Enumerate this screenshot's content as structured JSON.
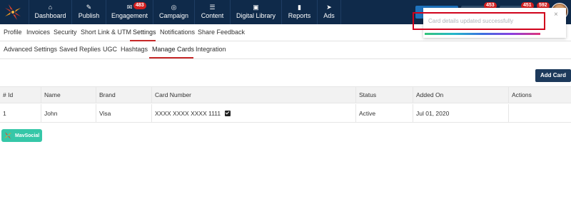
{
  "nav": {
    "items": [
      {
        "label": "Dashboard",
        "icon": "home-icon",
        "glyph": "⌂"
      },
      {
        "label": "Publish",
        "icon": "edit-icon",
        "glyph": "✎"
      },
      {
        "label": "Engagement",
        "icon": "envelope-icon",
        "glyph": "✉",
        "badge": "483"
      },
      {
        "label": "Campaign",
        "icon": "target-icon",
        "glyph": "◎"
      },
      {
        "label": "Content",
        "icon": "list-icon",
        "glyph": "☰"
      },
      {
        "label": "Digital Library",
        "icon": "briefcase-icon",
        "glyph": "▣"
      },
      {
        "label": "Reports",
        "icon": "bar-chart-icon",
        "glyph": "▮"
      },
      {
        "label": "Ads",
        "icon": "paper-plane-icon",
        "glyph": "➤"
      }
    ],
    "right_badges": [
      "453",
      "451",
      "592"
    ]
  },
  "tabs_primary": [
    "Profile",
    "Invoices",
    "Security",
    "Short Link & UTM",
    "Settings",
    "Notifications",
    "Share Feedback"
  ],
  "tabs_secondary": [
    "Advanced Settings",
    "Saved Replies",
    "UGC",
    "Hashtags",
    "Manage Cards",
    "Integration"
  ],
  "active_primary": "Settings",
  "active_secondary": "Manage Cards",
  "add_card_label": "Add Card",
  "table": {
    "headers": [
      "# Id",
      "Name",
      "Brand",
      "Card Number",
      "Status",
      "Added On",
      "Actions"
    ],
    "rows": [
      {
        "id": "1",
        "name": "John",
        "brand": "Visa",
        "card_number": "XXXX XXXX XXXX 1111",
        "status": "Active",
        "added_on": "Jul 01, 2020",
        "actions": ""
      }
    ]
  },
  "mav_badge_label": "MavSocial",
  "toast": {
    "message": "Card details updated successfully",
    "close": "×"
  },
  "colors": {
    "topbar": "#0f2a4a",
    "accent_red": "#c62828",
    "add_card_bg": "#1d3a5c",
    "mav_badge_bg": "#36c7a8"
  }
}
